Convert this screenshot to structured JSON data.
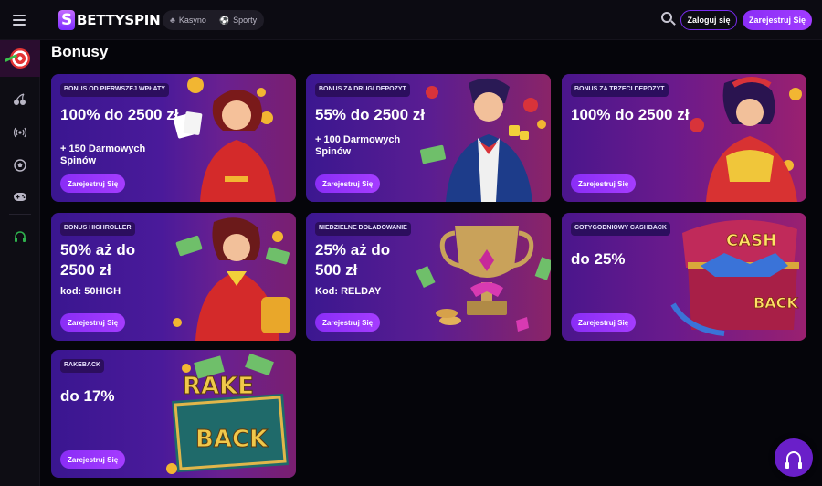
{
  "header": {
    "brand": "BETTYSPIN",
    "nav": [
      {
        "label": "Kasyno",
        "icon": "cherries-icon"
      },
      {
        "label": "Sporty",
        "icon": "soccer-ball-icon"
      }
    ],
    "login_label": "Zaloguj się",
    "register_label": "Zarejestruj Się"
  },
  "sidebar": {
    "items": [
      {
        "name": "dartboard-icon"
      },
      {
        "name": "cherries-icon"
      },
      {
        "name": "live-broadcast-icon"
      },
      {
        "name": "soccer-ball-icon"
      },
      {
        "name": "gamepad-icon"
      },
      {
        "name": "headset-support-icon"
      }
    ]
  },
  "page": {
    "title": "Bonusy"
  },
  "bonuses": [
    {
      "tag": "BONUS OD PIERWSZEJ WPŁATY",
      "title": "100% do 2500 zł",
      "sub": "+ 150 Darmowych Spinów",
      "button": "Zarejestruj Się"
    },
    {
      "tag": "BONUS ZA DRUGI DEPOZYT",
      "title": "55% do 2500 zł",
      "sub": "+ 100 Darmowych Spinów",
      "button": "Zarejestruj Się"
    },
    {
      "tag": "BONUS ZA TRZECI DEPOZYT",
      "title": "100% do 2500 zł",
      "sub": "",
      "button": "Zarejestruj Się"
    },
    {
      "tag": "BONUS HIGHROLLER",
      "title": "50% aż do 2500 zł",
      "sub": "kod: 50HIGH",
      "button": "Zarejestruj Się"
    },
    {
      "tag": "NIEDZIELNE DOŁADOWANIE",
      "title": "25% aż do 500 zł",
      "sub": "Kod: RELDAY",
      "button": "Zarejestruj Się"
    },
    {
      "tag": "COTYGODNIOWY CASHBACK",
      "title": "do 25%",
      "sub": "",
      "button": "Zarejestruj Się",
      "art_text": [
        "CASH",
        "BACK"
      ]
    },
    {
      "tag": "RAKEBACK",
      "title": "do 17%",
      "sub": "",
      "button": "Zarejestruj Się",
      "art_text": [
        "RAKE",
        "BACK"
      ]
    }
  ],
  "colors": {
    "accent": "#8a2df6",
    "background": "#05050a"
  }
}
